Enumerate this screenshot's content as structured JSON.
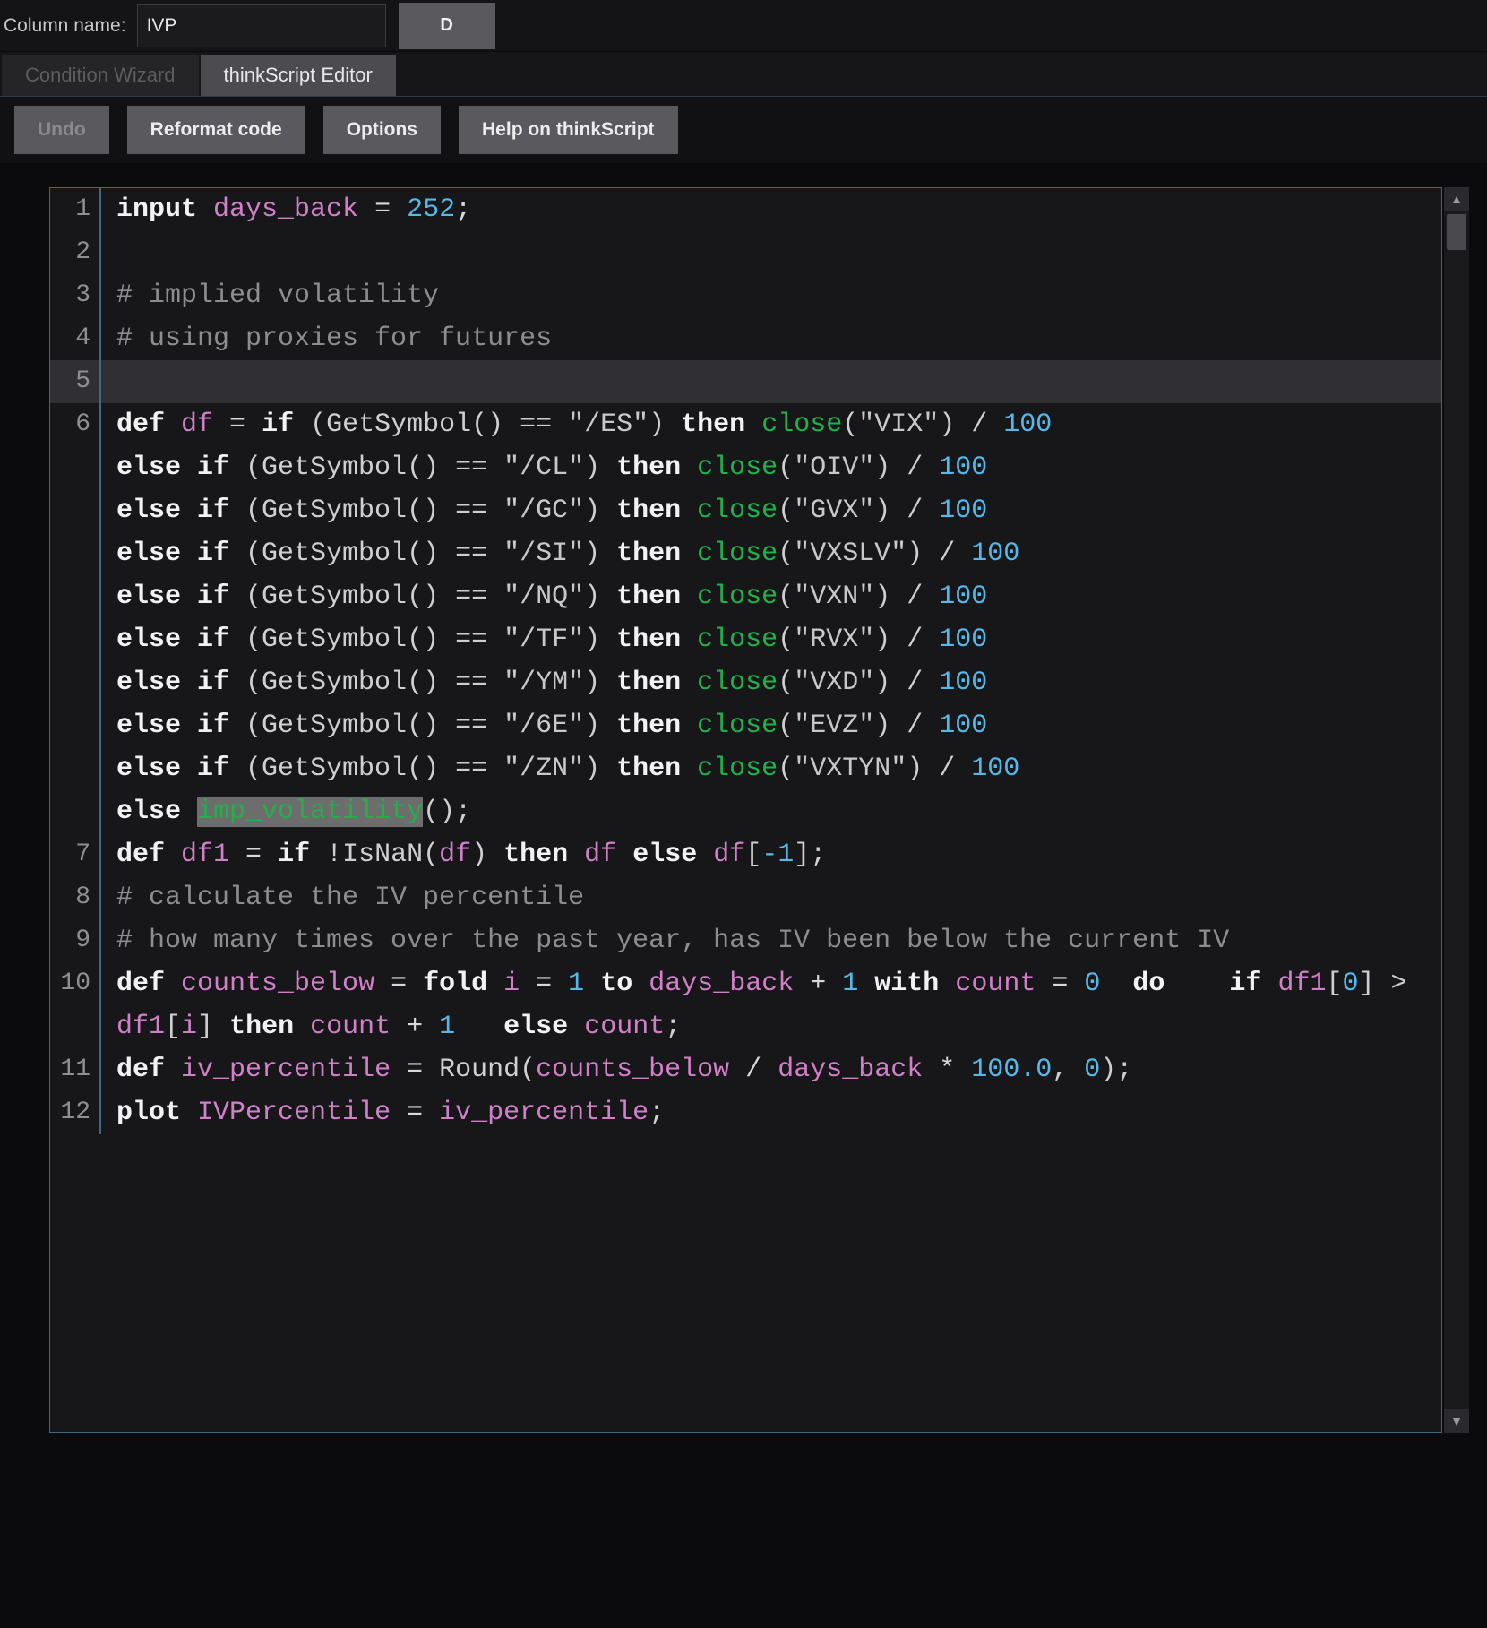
{
  "top_bar": {
    "column_label": "Column name:",
    "column_value": "IVP",
    "column_placeholder": "",
    "d_button": "D"
  },
  "tabs": [
    {
      "label": "Condition Wizard",
      "active": false,
      "disabled": true
    },
    {
      "label": "thinkScript Editor",
      "active": true,
      "disabled": false
    }
  ],
  "toolbar": {
    "undo": "Undo",
    "reformat": "Reformat code",
    "options": "Options",
    "help": "Help on thinkScript"
  },
  "colors": {
    "keyword": "#f2f2f2",
    "variable": "#d17fc8",
    "number": "#55b8e8",
    "comment": "#8d8d8d",
    "function": "#21b14b",
    "string": "#c8c8c8",
    "selection": "#6d6d6d",
    "editor_bg": "#17171a",
    "current_line_bg": "#303034",
    "border": "#3c6a84"
  },
  "editor": {
    "current_line": 5,
    "selection_text": "imp_volatility",
    "lines": [
      {
        "number": "1",
        "tokens": [
          {
            "t": "input",
            "c": "kw"
          },
          {
            "t": " ",
            "c": "plain"
          },
          {
            "t": "days_back",
            "c": "var"
          },
          {
            "t": " = ",
            "c": "op"
          },
          {
            "t": "252",
            "c": "num"
          },
          {
            "t": ";",
            "c": "op"
          }
        ]
      },
      {
        "number": "2",
        "tokens": []
      },
      {
        "number": "3",
        "tokens": [
          {
            "t": "# implied volatility",
            "c": "cmt"
          }
        ]
      },
      {
        "number": "4",
        "tokens": [
          {
            "t": "# using proxies for futures",
            "c": "cmt"
          }
        ]
      },
      {
        "number": "5",
        "tokens": []
      },
      {
        "number": "6",
        "tokens": [
          {
            "t": "def",
            "c": "kw"
          },
          {
            "t": " ",
            "c": "plain"
          },
          {
            "t": "df",
            "c": "var"
          },
          {
            "t": " = ",
            "c": "op"
          },
          {
            "t": "if",
            "c": "kw"
          },
          {
            "t": " (GetSymbol() == ",
            "c": "plain"
          },
          {
            "t": "\"/ES\"",
            "c": "str"
          },
          {
            "t": ") ",
            "c": "plain"
          },
          {
            "t": "then",
            "c": "kw"
          },
          {
            "t": " ",
            "c": "plain"
          },
          {
            "t": "close",
            "c": "fn"
          },
          {
            "t": "(",
            "c": "plain"
          },
          {
            "t": "\"VIX\"",
            "c": "str"
          },
          {
            "t": ") / ",
            "c": "plain"
          },
          {
            "t": "100",
            "c": "num"
          },
          {
            "t": "\n",
            "c": "plain"
          },
          {
            "t": "else if",
            "c": "kw"
          },
          {
            "t": " (GetSymbol() == ",
            "c": "plain"
          },
          {
            "t": "\"/CL\"",
            "c": "str"
          },
          {
            "t": ") ",
            "c": "plain"
          },
          {
            "t": "then",
            "c": "kw"
          },
          {
            "t": " ",
            "c": "plain"
          },
          {
            "t": "close",
            "c": "fn"
          },
          {
            "t": "(",
            "c": "plain"
          },
          {
            "t": "\"OIV\"",
            "c": "str"
          },
          {
            "t": ") / ",
            "c": "plain"
          },
          {
            "t": "100",
            "c": "num"
          },
          {
            "t": "\n",
            "c": "plain"
          },
          {
            "t": "else if",
            "c": "kw"
          },
          {
            "t": " (GetSymbol() == ",
            "c": "plain"
          },
          {
            "t": "\"/GC\"",
            "c": "str"
          },
          {
            "t": ") ",
            "c": "plain"
          },
          {
            "t": "then",
            "c": "kw"
          },
          {
            "t": " ",
            "c": "plain"
          },
          {
            "t": "close",
            "c": "fn"
          },
          {
            "t": "(",
            "c": "plain"
          },
          {
            "t": "\"GVX\"",
            "c": "str"
          },
          {
            "t": ") / ",
            "c": "plain"
          },
          {
            "t": "100",
            "c": "num"
          },
          {
            "t": "\n",
            "c": "plain"
          },
          {
            "t": "else if",
            "c": "kw"
          },
          {
            "t": " (GetSymbol() == ",
            "c": "plain"
          },
          {
            "t": "\"/SI\"",
            "c": "str"
          },
          {
            "t": ") ",
            "c": "plain"
          },
          {
            "t": "then",
            "c": "kw"
          },
          {
            "t": " ",
            "c": "plain"
          },
          {
            "t": "close",
            "c": "fn"
          },
          {
            "t": "(",
            "c": "plain"
          },
          {
            "t": "\"VXSLV\"",
            "c": "str"
          },
          {
            "t": ") / ",
            "c": "plain"
          },
          {
            "t": "100",
            "c": "num"
          },
          {
            "t": "\n",
            "c": "plain"
          },
          {
            "t": "else if",
            "c": "kw"
          },
          {
            "t": " (GetSymbol() == ",
            "c": "plain"
          },
          {
            "t": "\"/NQ\"",
            "c": "str"
          },
          {
            "t": ") ",
            "c": "plain"
          },
          {
            "t": "then",
            "c": "kw"
          },
          {
            "t": " ",
            "c": "plain"
          },
          {
            "t": "close",
            "c": "fn"
          },
          {
            "t": "(",
            "c": "plain"
          },
          {
            "t": "\"VXN\"",
            "c": "str"
          },
          {
            "t": ") / ",
            "c": "plain"
          },
          {
            "t": "100",
            "c": "num"
          },
          {
            "t": "\n",
            "c": "plain"
          },
          {
            "t": "else if",
            "c": "kw"
          },
          {
            "t": " (GetSymbol() == ",
            "c": "plain"
          },
          {
            "t": "\"/TF\"",
            "c": "str"
          },
          {
            "t": ") ",
            "c": "plain"
          },
          {
            "t": "then",
            "c": "kw"
          },
          {
            "t": " ",
            "c": "plain"
          },
          {
            "t": "close",
            "c": "fn"
          },
          {
            "t": "(",
            "c": "plain"
          },
          {
            "t": "\"RVX\"",
            "c": "str"
          },
          {
            "t": ") / ",
            "c": "plain"
          },
          {
            "t": "100",
            "c": "num"
          },
          {
            "t": "\n",
            "c": "plain"
          },
          {
            "t": "else if",
            "c": "kw"
          },
          {
            "t": " (GetSymbol() == ",
            "c": "plain"
          },
          {
            "t": "\"/YM\"",
            "c": "str"
          },
          {
            "t": ") ",
            "c": "plain"
          },
          {
            "t": "then",
            "c": "kw"
          },
          {
            "t": " ",
            "c": "plain"
          },
          {
            "t": "close",
            "c": "fn"
          },
          {
            "t": "(",
            "c": "plain"
          },
          {
            "t": "\"VXD\"",
            "c": "str"
          },
          {
            "t": ") / ",
            "c": "plain"
          },
          {
            "t": "100",
            "c": "num"
          },
          {
            "t": "\n",
            "c": "plain"
          },
          {
            "t": "else if",
            "c": "kw"
          },
          {
            "t": " (GetSymbol() == ",
            "c": "plain"
          },
          {
            "t": "\"/6E\"",
            "c": "str"
          },
          {
            "t": ") ",
            "c": "plain"
          },
          {
            "t": "then",
            "c": "kw"
          },
          {
            "t": " ",
            "c": "plain"
          },
          {
            "t": "close",
            "c": "fn"
          },
          {
            "t": "(",
            "c": "plain"
          },
          {
            "t": "\"EVZ\"",
            "c": "str"
          },
          {
            "t": ") / ",
            "c": "plain"
          },
          {
            "t": "100",
            "c": "num"
          },
          {
            "t": "\n",
            "c": "plain"
          },
          {
            "t": "else if",
            "c": "kw"
          },
          {
            "t": " (GetSymbol() == ",
            "c": "plain"
          },
          {
            "t": "\"/ZN\"",
            "c": "str"
          },
          {
            "t": ") ",
            "c": "plain"
          },
          {
            "t": "then",
            "c": "kw"
          },
          {
            "t": " ",
            "c": "plain"
          },
          {
            "t": "close",
            "c": "fn"
          },
          {
            "t": "(",
            "c": "plain"
          },
          {
            "t": "\"VXTYN\"",
            "c": "str"
          },
          {
            "t": ") / ",
            "c": "plain"
          },
          {
            "t": "100",
            "c": "num"
          },
          {
            "t": "\n",
            "c": "plain"
          },
          {
            "t": "else",
            "c": "kw"
          },
          {
            "t": " ",
            "c": "plain"
          },
          {
            "t": "imp_volatility",
            "c": "fn",
            "sel": true
          },
          {
            "t": "();",
            "c": "plain"
          }
        ]
      },
      {
        "number": "7",
        "tokens": [
          {
            "t": "def",
            "c": "kw"
          },
          {
            "t": " ",
            "c": "plain"
          },
          {
            "t": "df1",
            "c": "var"
          },
          {
            "t": " = ",
            "c": "op"
          },
          {
            "t": "if",
            "c": "kw"
          },
          {
            "t": " !IsNaN(",
            "c": "plain"
          },
          {
            "t": "df",
            "c": "var"
          },
          {
            "t": ") ",
            "c": "plain"
          },
          {
            "t": "then",
            "c": "kw"
          },
          {
            "t": " ",
            "c": "plain"
          },
          {
            "t": "df",
            "c": "var"
          },
          {
            "t": " ",
            "c": "plain"
          },
          {
            "t": "else",
            "c": "kw"
          },
          {
            "t": " ",
            "c": "plain"
          },
          {
            "t": "df",
            "c": "var"
          },
          {
            "t": "[",
            "c": "plain"
          },
          {
            "t": "-1",
            "c": "num"
          },
          {
            "t": "];",
            "c": "plain"
          }
        ]
      },
      {
        "number": "8",
        "tokens": [
          {
            "t": "# calculate the IV percentile",
            "c": "cmt"
          }
        ]
      },
      {
        "number": "9",
        "tokens": [
          {
            "t": "# how many times over the past year, has IV been below the current IV",
            "c": "cmt"
          }
        ]
      },
      {
        "number": "10",
        "tokens": [
          {
            "t": "def",
            "c": "kw"
          },
          {
            "t": " ",
            "c": "plain"
          },
          {
            "t": "counts_below",
            "c": "var"
          },
          {
            "t": " = ",
            "c": "op"
          },
          {
            "t": "fold",
            "c": "kw"
          },
          {
            "t": " ",
            "c": "plain"
          },
          {
            "t": "i",
            "c": "var"
          },
          {
            "t": " = ",
            "c": "op"
          },
          {
            "t": "1",
            "c": "num"
          },
          {
            "t": " ",
            "c": "plain"
          },
          {
            "t": "to",
            "c": "kw"
          },
          {
            "t": " ",
            "c": "plain"
          },
          {
            "t": "days_back",
            "c": "var"
          },
          {
            "t": " + ",
            "c": "op"
          },
          {
            "t": "1",
            "c": "num"
          },
          {
            "t": " ",
            "c": "plain"
          },
          {
            "t": "with",
            "c": "kw"
          },
          {
            "t": " ",
            "c": "plain"
          },
          {
            "t": "count",
            "c": "var"
          },
          {
            "t": " = ",
            "c": "op"
          },
          {
            "t": "0",
            "c": "num"
          },
          {
            "t": "  ",
            "c": "plain"
          },
          {
            "t": "do",
            "c": "kw"
          },
          {
            "t": "    ",
            "c": "plain"
          },
          {
            "t": "if",
            "c": "kw"
          },
          {
            "t": " ",
            "c": "plain"
          },
          {
            "t": "df1",
            "c": "var"
          },
          {
            "t": "[",
            "c": "plain"
          },
          {
            "t": "0",
            "c": "num"
          },
          {
            "t": "] > ",
            "c": "plain"
          },
          {
            "t": "df1",
            "c": "var"
          },
          {
            "t": "[",
            "c": "plain"
          },
          {
            "t": "i",
            "c": "var"
          },
          {
            "t": "] ",
            "c": "plain"
          },
          {
            "t": "then",
            "c": "kw"
          },
          {
            "t": " ",
            "c": "plain"
          },
          {
            "t": "count",
            "c": "var"
          },
          {
            "t": " + ",
            "c": "op"
          },
          {
            "t": "1",
            "c": "num"
          },
          {
            "t": "   ",
            "c": "plain"
          },
          {
            "t": "else",
            "c": "kw"
          },
          {
            "t": " ",
            "c": "plain"
          },
          {
            "t": "count",
            "c": "var"
          },
          {
            "t": ";",
            "c": "plain"
          }
        ]
      },
      {
        "number": "11",
        "tokens": [
          {
            "t": "def",
            "c": "kw"
          },
          {
            "t": " ",
            "c": "plain"
          },
          {
            "t": "iv_percentile",
            "c": "var"
          },
          {
            "t": " = ",
            "c": "op"
          },
          {
            "t": "Round(",
            "c": "plain"
          },
          {
            "t": "counts_below",
            "c": "var"
          },
          {
            "t": " / ",
            "c": "op"
          },
          {
            "t": "days_back",
            "c": "var"
          },
          {
            "t": " * ",
            "c": "op"
          },
          {
            "t": "100.0",
            "c": "num"
          },
          {
            "t": ", ",
            "c": "plain"
          },
          {
            "t": "0",
            "c": "num"
          },
          {
            "t": ");",
            "c": "plain"
          }
        ]
      },
      {
        "number": "12",
        "tokens": [
          {
            "t": "plot",
            "c": "kw"
          },
          {
            "t": " ",
            "c": "plain"
          },
          {
            "t": "IVPercentile",
            "c": "var"
          },
          {
            "t": " = ",
            "c": "op"
          },
          {
            "t": "iv_percentile",
            "c": "var"
          },
          {
            "t": ";",
            "c": "plain"
          }
        ]
      }
    ]
  },
  "scrollbar": {
    "up_arrow": "▲",
    "down_arrow": "▼"
  }
}
